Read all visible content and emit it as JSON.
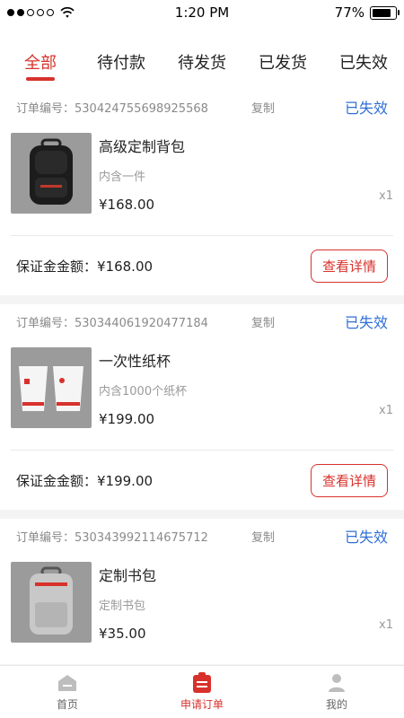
{
  "status_bar": {
    "time": "1:20 PM",
    "battery": "77%"
  },
  "tabs": [
    {
      "label": "全部"
    },
    {
      "label": "待付款"
    },
    {
      "label": "待发货"
    },
    {
      "label": "已发货"
    },
    {
      "label": "已失效"
    }
  ],
  "orders": [
    {
      "order_no": "订单编号：530424755698925568",
      "copy_label": "复制",
      "status": "已失效",
      "product": {
        "name": "高级定制背包",
        "desc": "内含一件",
        "price": "¥168.00",
        "qty": "x1",
        "image_icon": "backpack-icon"
      },
      "deposit": "保证金金额：¥168.00",
      "detail_label": "查看详情"
    },
    {
      "order_no": "订单编号：530344061920477184",
      "copy_label": "复制",
      "status": "已失效",
      "product": {
        "name": "一次性纸杯",
        "desc": "内含1000个纸杯",
        "price": "¥199.00",
        "qty": "x1",
        "image_icon": "paper-cups-icon"
      },
      "deposit": "保证金金额：¥199.00",
      "detail_label": "查看详情"
    },
    {
      "order_no": "订单编号：530343992114675712",
      "copy_label": "复制",
      "status": "已失效",
      "product": {
        "name": "定制书包",
        "desc": "定制书包",
        "price": "¥35.00",
        "qty": "x1",
        "image_icon": "school-bag-icon"
      }
    }
  ],
  "nav": [
    {
      "label": "首页",
      "icon": "home-icon"
    },
    {
      "label": "申请订单",
      "icon": "clipboard-icon"
    },
    {
      "label": "我的",
      "icon": "user-icon"
    }
  ],
  "colors": {
    "accent": "#d8312c",
    "status_blue": "#2f6fd6"
  }
}
